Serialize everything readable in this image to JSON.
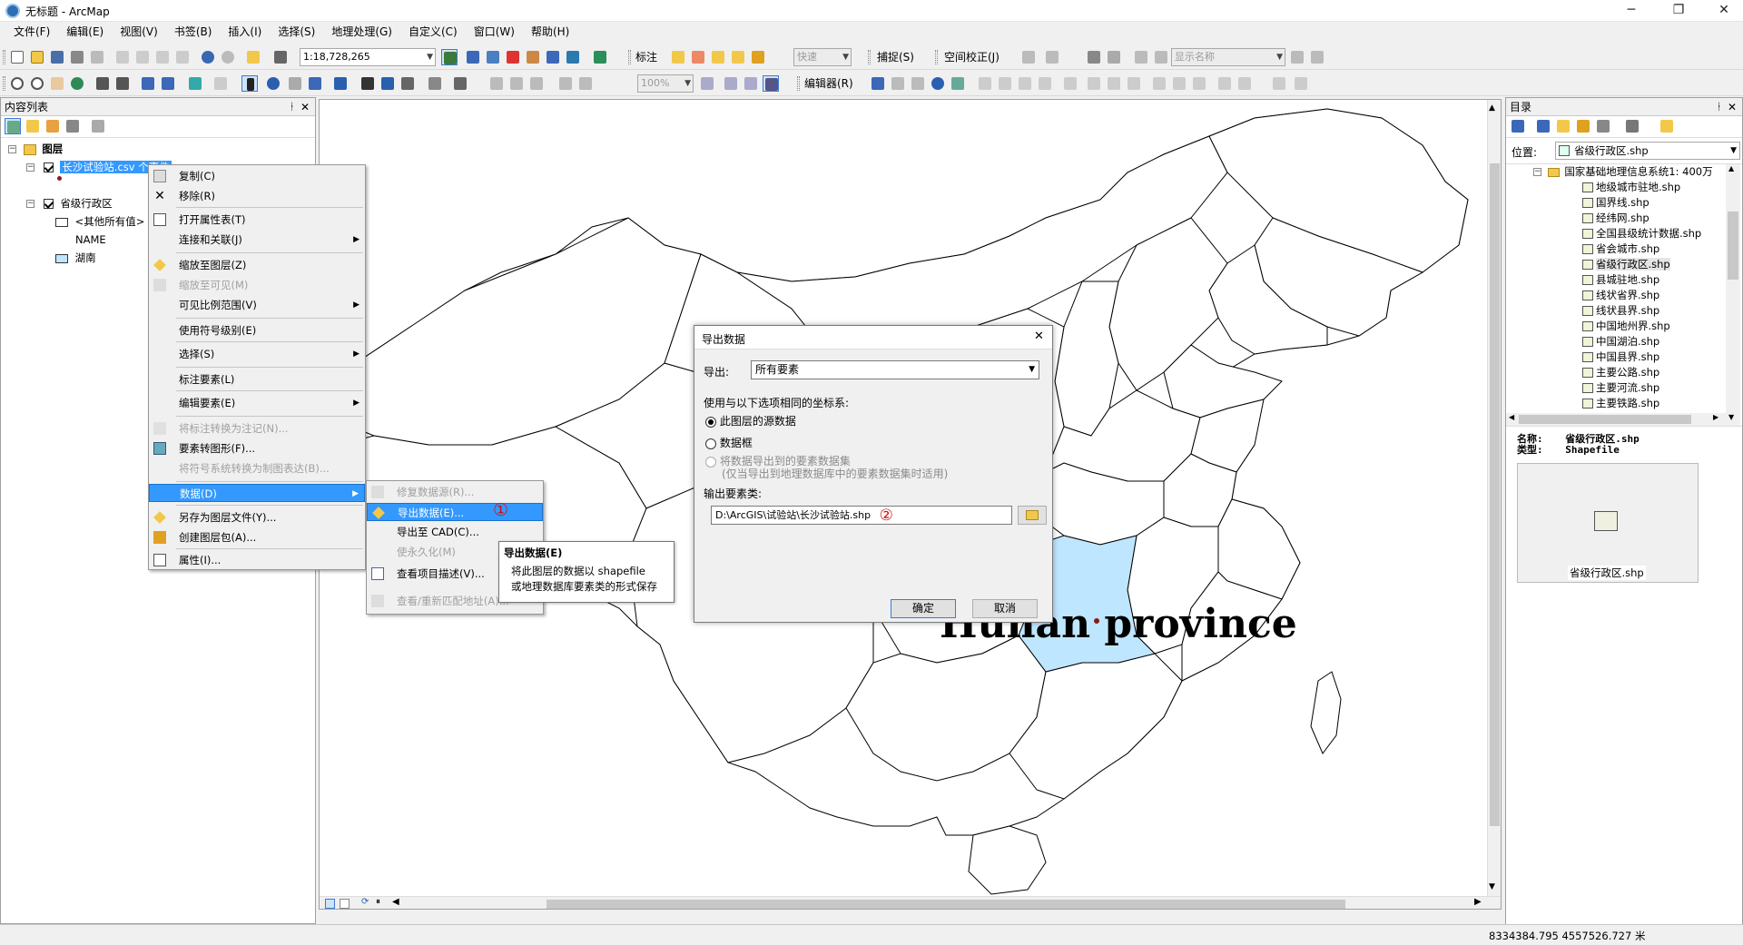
{
  "window": {
    "title": "无标题 - ArcMap",
    "controls": [
      "─",
      "❐",
      "✕"
    ]
  },
  "menu": [
    "文件(F)",
    "编辑(E)",
    "视图(V)",
    "书签(B)",
    "插入(I)",
    "选择(S)",
    "地理处理(G)",
    "自定义(C)",
    "窗口(W)",
    "帮助(H)"
  ],
  "toolbar1": {
    "scale": "1:18,728,265",
    "annotation_label": "标注",
    "quick_label": "快速",
    "snap_label": "捕捉(S)",
    "georef_label": "空间校正(J)",
    "display_name": "显示名称"
  },
  "toolbar2": {
    "zoom_pct": "100%",
    "editor_label": "编辑器(R)"
  },
  "toc": {
    "title": "内容列表",
    "pin": "ᛂ",
    "close": "✕",
    "root": "图层",
    "layer1": "长沙试验站.csv 个事件",
    "layer2": "省级行政区",
    "layer2_other": "<其他所有值>",
    "layer2_field": "NAME",
    "layer2_value": "湖南"
  },
  "context_menu": {
    "items": [
      "复制(C)",
      "移除(R)",
      "打开属性表(T)",
      "连接和关联(J)",
      "缩放至图层(Z)",
      "缩放至可见(M)",
      "可见比例范围(V)",
      "使用符号级别(E)",
      "选择(S)",
      "标注要素(L)",
      "编辑要素(E)",
      "将标注转换为注记(N)...",
      "要素转图形(F)...",
      "将符号系统转换为制图表达(B)...",
      "数据(D)",
      "另存为图层文件(Y)...",
      "创建图层包(A)...",
      "属性(I)..."
    ]
  },
  "submenu": {
    "items": [
      "修复数据源(R)...",
      "导出数据(E)...",
      "导出至 CAD(C)...",
      "使永久化(M)",
      "查看项目描述(V)...",
      "查看/重新匹配地址(A)..."
    ],
    "marker1": "①"
  },
  "tooltip": {
    "title": "导出数据(E)",
    "line1": "将此图层的数据以 shapefile",
    "line2": "或地理数据库要素类的形式保存"
  },
  "dialog": {
    "title": "导出数据",
    "export_label": "导出:",
    "export_value": "所有要素",
    "coord_label": "使用与以下选项相同的坐标系:",
    "opt1": "此图层的源数据",
    "opt2": "数据框",
    "opt3_line1": "将数据导出到的要素数据集",
    "opt3_line2": "(仅当导出到地理数据库中的要素数据集时适用)",
    "output_label": "输出要素类:",
    "output_path": "D:\\ArcGIS\\试验站\\长沙试验站.shp",
    "marker2": "②",
    "ok": "确定",
    "cancel": "取消"
  },
  "map": {
    "overlay_label": "Hunan province",
    "highlight_color": "#bfe6ff"
  },
  "catalog": {
    "title": "目录",
    "location_label": "位置:",
    "location_value": "省级行政区.shp",
    "root": "国家基础地理信息系统1: 400万",
    "files": [
      "地级城市驻地.shp",
      "国界线.shp",
      "经纬网.shp",
      "全国县级统计数据.shp",
      "省会城市.shp",
      "省级行政区.shp",
      "县城驻地.shp",
      "线状省界.shp",
      "线状县界.shp",
      "中国地州界.shp",
      "中国湖泊.shp",
      "中国县界.shp",
      "主要公路.shp",
      "主要河流.shp",
      "主要铁路.shp"
    ],
    "selected_index": 5,
    "name_label": "名称:",
    "name_value": "省级行政区.shp",
    "type_label": "类型:",
    "type_value": "Shapefile",
    "thumb_caption": "省级行政区.shp"
  },
  "status": {
    "coords": "8334384.795  4557526.727 米"
  }
}
